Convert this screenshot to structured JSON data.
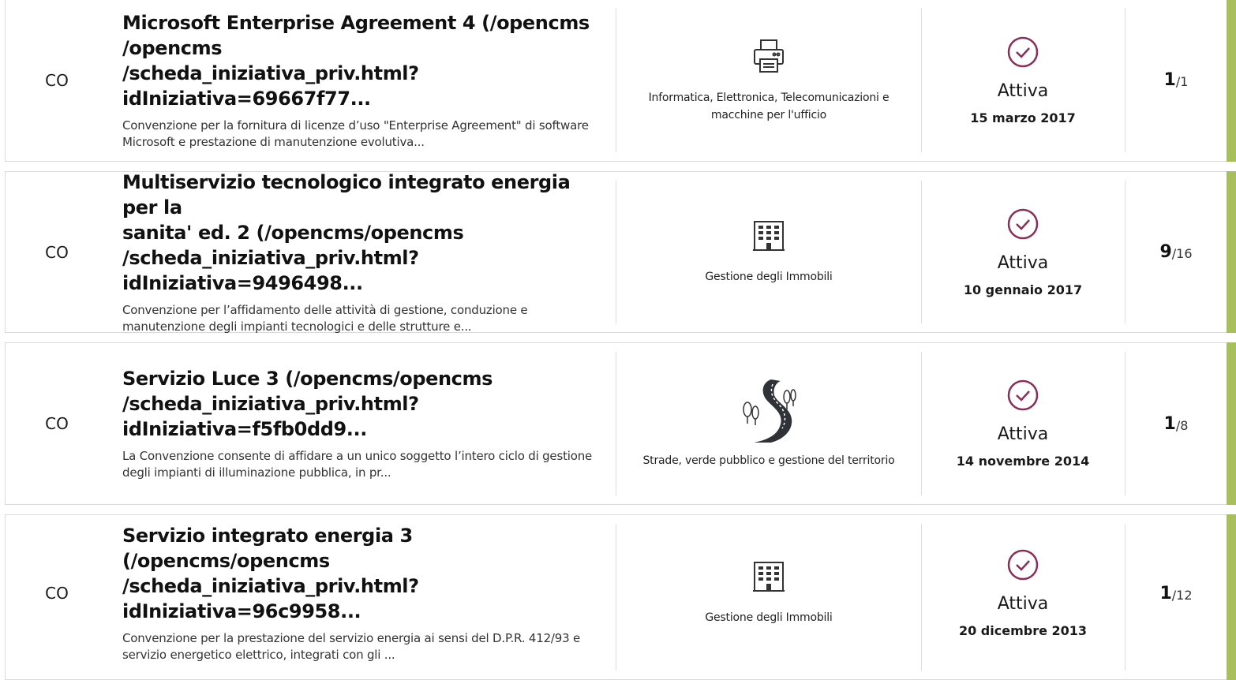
{
  "colors": {
    "accent": "#a8c05b",
    "check": "#8b2e55",
    "border": "#d9d9d9"
  },
  "items": [
    {
      "type": "CO",
      "title": "Microsoft Enterprise Agreement 4 (/opencms /opencms /scheda_iniziativa_priv.html?idIniziativa=69667f77...",
      "title_lines": [
        "Microsoft Enterprise Agreement 4 (/opencms",
        "/opencms",
        "/scheda_iniziativa_priv.html?idIniziativa=69667f77..."
      ],
      "description_lines": [
        "Convenzione per la fornitura di licenze d’uso \"Enterprise Agreement\" di software",
        "Microsoft e prestazione di manutenzione evolutiva..."
      ],
      "category_icon": "printer-icon",
      "category_lines": [
        "Informatica, Elettronica, Telecomunicazioni e",
        "macchine per l'ufficio"
      ],
      "status": "Attiva",
      "date": "15 marzo 2017",
      "count": "1",
      "total": "/1"
    },
    {
      "type": "CO",
      "title_lines": [
        "Multiservizio tecnologico integrato energia per la",
        "sanita' ed. 2 (/opencms/opencms",
        "/scheda_iniziativa_priv.html?idIniziativa=9496498..."
      ],
      "description_lines": [
        "Convenzione per l’affidamento delle attività di gestione, conduzione e",
        "manutenzione degli impianti tecnologici e delle strutture e..."
      ],
      "category_icon": "building-icon",
      "category_lines": [
        "Gestione degli Immobili"
      ],
      "status": "Attiva",
      "date": "10 gennaio 2017",
      "count": "9",
      "total": "/16"
    },
    {
      "type": "CO",
      "title_lines": [
        "Servizio Luce 3 (/opencms/opencms",
        "/scheda_iniziativa_priv.html?idIniziativa=f5fb0dd9..."
      ],
      "description_lines": [
        "La Convenzione consente di affidare a un unico soggetto l’intero ciclo di gestione",
        "degli impianti di illuminazione pubblica, in pr..."
      ],
      "category_icon": "road-trees-icon",
      "category_lines": [
        "Strade, verde pubblico e gestione del territorio"
      ],
      "status": "Attiva",
      "date": "14 novembre 2014",
      "count": "1",
      "total": "/8"
    },
    {
      "type": "CO",
      "title_lines": [
        "Servizio integrato energia 3 (/opencms/opencms",
        "/scheda_iniziativa_priv.html?idIniziativa=96c9958..."
      ],
      "description_lines": [
        "Convenzione per la prestazione del servizio energia ai sensi del D.P.R. 412/93 e",
        "servizio energetico elettrico, integrati con gli ..."
      ],
      "category_icon": "building-icon",
      "category_lines": [
        "Gestione degli Immobili"
      ],
      "status": "Attiva",
      "date": "20 dicembre 2013",
      "count": "1",
      "total": "/12"
    }
  ]
}
